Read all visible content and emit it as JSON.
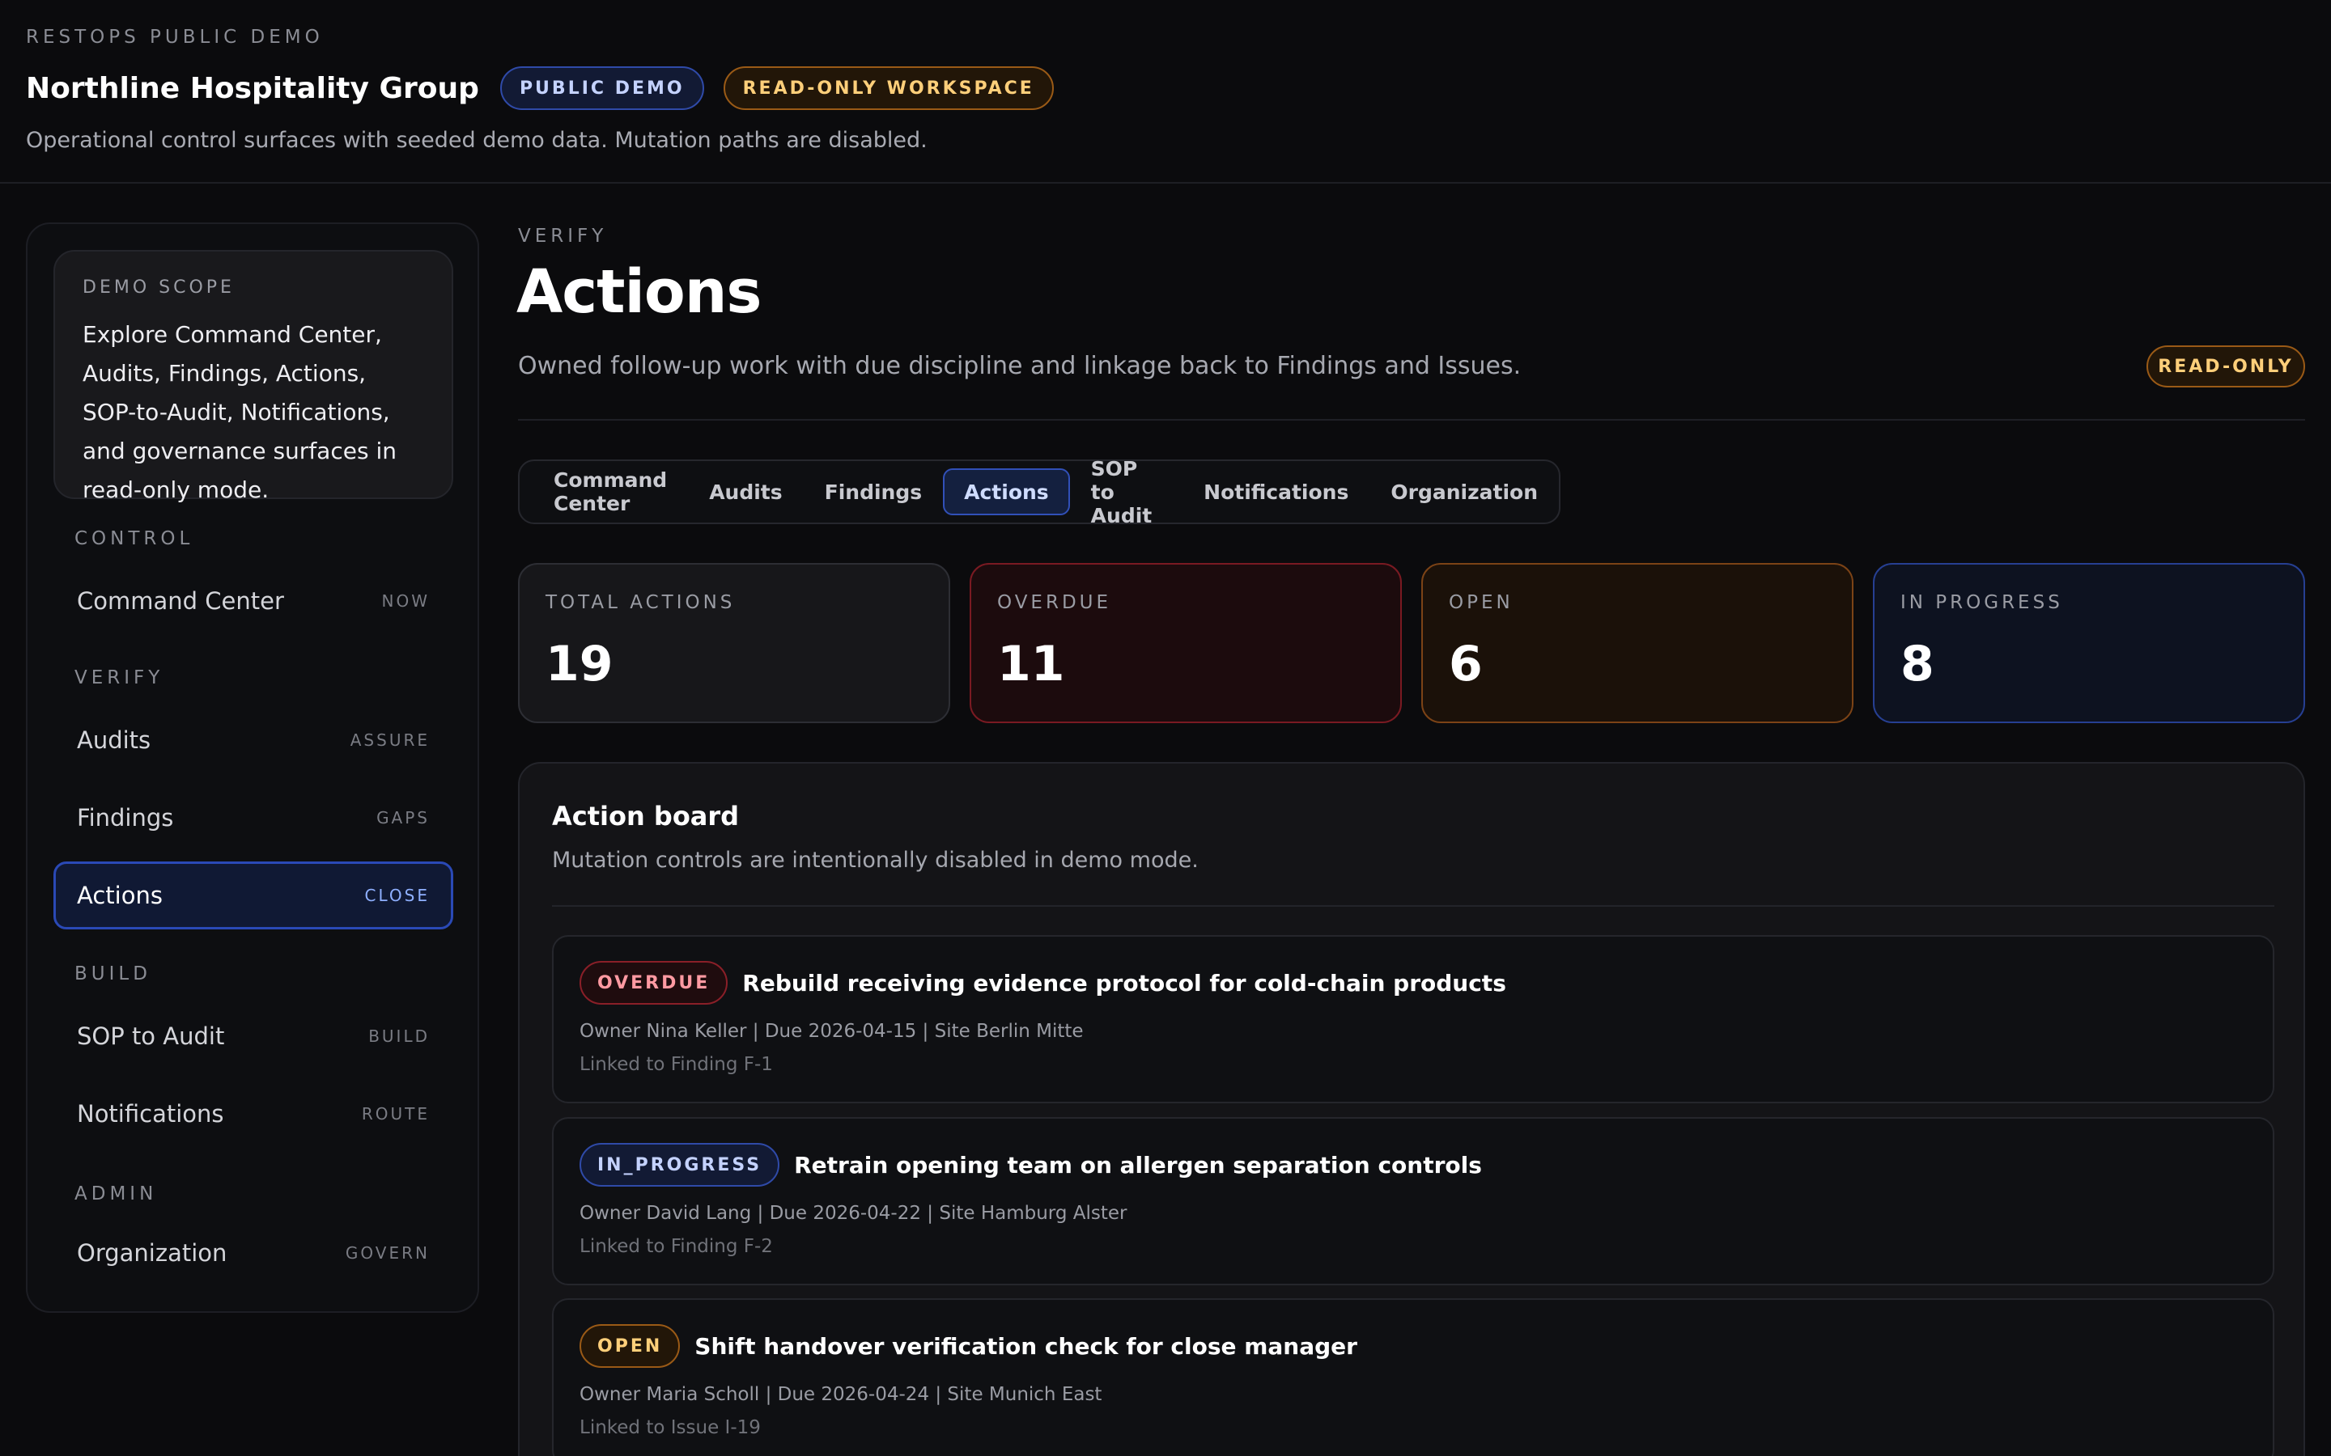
{
  "header": {
    "eyebrow": "RESTOPS PUBLIC DEMO",
    "title": "Northline Hospitality Group",
    "badge_public": "PUBLIC DEMO",
    "badge_readonly": "READ-ONLY WORKSPACE",
    "subtitle": "Operational control surfaces with seeded demo data. Mutation paths are disabled."
  },
  "sidebar": {
    "scope_label": "DEMO SCOPE",
    "scope_text": "Explore Command Center, Audits, Findings, Actions, SOP-to-Audit, Notifications, and governance surfaces in read-only mode.",
    "sections": {
      "control": "CONTROL",
      "verify": "VERIFY",
      "build": "BUILD",
      "admin": "ADMIN"
    },
    "items": [
      {
        "label": "Command Center",
        "hint": "NOW"
      },
      {
        "label": "Audits",
        "hint": "ASSURE"
      },
      {
        "label": "Findings",
        "hint": "GAPS"
      },
      {
        "label": "Actions",
        "hint": "CLOSE"
      },
      {
        "label": "SOP to Audit",
        "hint": "BUILD"
      },
      {
        "label": "Notifications",
        "hint": "ROUTE"
      },
      {
        "label": "Organization",
        "hint": "GOVERN"
      }
    ]
  },
  "page": {
    "eyebrow": "VERIFY",
    "title": "Actions",
    "subtitle": "Owned follow-up work with due discipline and linkage back to Findings and Issues.",
    "badge": "READ-ONLY"
  },
  "tabs": [
    "Command Center",
    "Audits",
    "Findings",
    "Actions",
    "SOP to Audit",
    "Notifications",
    "Organization"
  ],
  "stats": [
    {
      "label": "TOTAL ACTIONS",
      "value": "19"
    },
    {
      "label": "OVERDUE",
      "value": "11"
    },
    {
      "label": "OPEN",
      "value": "6"
    },
    {
      "label": "IN PROGRESS",
      "value": "8"
    }
  ],
  "board": {
    "title": "Action board",
    "subtitle": "Mutation controls are intentionally disabled in demo mode.",
    "actions": [
      {
        "status": "OVERDUE",
        "title": "Rebuild receiving evidence protocol for cold-chain products",
        "meta": "Owner Nina Keller | Due 2026-04-15 | Site Berlin Mitte",
        "link": "Linked to Finding F-1"
      },
      {
        "status": "IN_PROGRESS",
        "title": "Retrain opening team on allergen separation controls",
        "meta": "Owner David Lang | Due 2026-04-22 | Site Hamburg Alster",
        "link": "Linked to Finding F-2"
      },
      {
        "status": "OPEN",
        "title": "Shift handover verification check for close manager",
        "meta": "Owner Maria Scholl | Due 2026-04-24 | Site Munich East",
        "link": "Linked to Issue I-19"
      }
    ]
  },
  "colors": {
    "background": "#0b0b0d",
    "accent_blue": "#2f4aa8",
    "accent_amber": "#9a5a16",
    "accent_red": "#8a1f28"
  }
}
